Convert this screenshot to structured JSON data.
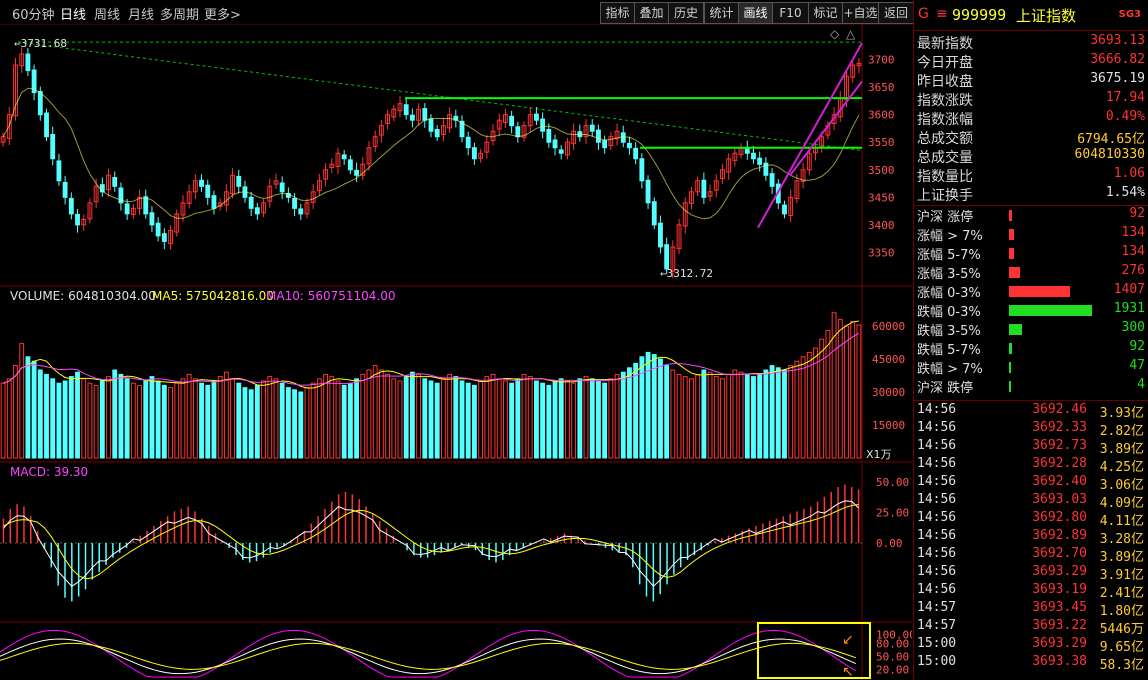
{
  "toolbar": {
    "tabs": [
      "60分钟",
      "日线",
      "周线",
      "月线",
      "多周期",
      "更多>"
    ],
    "active_tab": "日线",
    "tools": [
      "指标",
      "叠加",
      "历史",
      "统计",
      "画线",
      "F10",
      "标记",
      "+自选",
      "返回"
    ],
    "active_tool": "画线"
  },
  "chart_data": [
    {
      "type": "candlestick",
      "pane": "price",
      "title": "",
      "ylim": [
        3300,
        3750
      ],
      "y_ticks": [
        "3700",
        "3650",
        "3600",
        "3550",
        "3500",
        "3450",
        "3400",
        "3350"
      ],
      "annotations": [
        "3731.68",
        "3312.72"
      ],
      "high_marker": 3731.68,
      "low_marker": 3312.72,
      "close": [
        3560,
        3600,
        3690,
        3710,
        3680,
        3640,
        3600,
        3560,
        3520,
        3480,
        3450,
        3420,
        3400,
        3410,
        3440,
        3470,
        3460,
        3490,
        3470,
        3440,
        3420,
        3430,
        3450,
        3420,
        3400,
        3380,
        3370,
        3390,
        3420,
        3440,
        3460,
        3480,
        3470,
        3450,
        3430,
        3440,
        3460,
        3490,
        3470,
        3450,
        3430,
        3420,
        3440,
        3470,
        3480,
        3460,
        3450,
        3430,
        3420,
        3440,
        3460,
        3480,
        3500,
        3510,
        3530,
        3520,
        3500,
        3490,
        3510,
        3540,
        3560,
        3580,
        3600,
        3610,
        3620,
        3600,
        3590,
        3610,
        3590,
        3570,
        3560,
        3580,
        3600,
        3590,
        3560,
        3540,
        3520,
        3530,
        3550,
        3570,
        3590,
        3600,
        3580,
        3560,
        3580,
        3600,
        3590,
        3570,
        3550,
        3540,
        3530,
        3550,
        3570,
        3560,
        3580,
        3570,
        3550,
        3540,
        3560,
        3570,
        3550,
        3540,
        3520,
        3480,
        3440,
        3400,
        3360,
        3320,
        3360,
        3400,
        3440,
        3460,
        3480,
        3450,
        3460,
        3480,
        3500,
        3520,
        3530,
        3540,
        3530,
        3520,
        3510,
        3490,
        3470,
        3440,
        3420,
        3450,
        3480,
        3500,
        3530,
        3540,
        3560,
        3580,
        3600,
        3630,
        3670,
        3690,
        3693
      ]
    },
    {
      "type": "bar",
      "pane": "volume",
      "legend": [
        "VOLUME: 604810304.00",
        "MA5: 575042816.00",
        "MA10: 560751104.00"
      ],
      "ylim": [
        0,
        70000
      ],
      "y_ticks": [
        "60000",
        "45000",
        "30000",
        "15000"
      ],
      "unit_label": "X1万",
      "values": [
        34000,
        36000,
        42000,
        52000,
        46000,
        44000,
        40000,
        38000,
        36000,
        34000,
        35000,
        37000,
        39000,
        36000,
        34000,
        33000,
        35000,
        37000,
        40000,
        38000,
        36000,
        34000,
        33000,
        35000,
        37000,
        35000,
        33000,
        32000,
        34000,
        36000,
        38000,
        36000,
        34000,
        33000,
        35000,
        37000,
        39000,
        36000,
        34000,
        32000,
        31000,
        33000,
        35000,
        37000,
        36000,
        34000,
        32000,
        31000,
        30000,
        32000,
        34000,
        36000,
        38000,
        37000,
        35000,
        33000,
        34000,
        36000,
        38000,
        40000,
        42000,
        40000,
        38000,
        36000,
        35000,
        37000,
        39000,
        38000,
        36000,
        35000,
        34000,
        36000,
        38000,
        37000,
        35000,
        34000,
        33000,
        35000,
        37000,
        38000,
        36000,
        35000,
        34000,
        36000,
        38000,
        37000,
        35000,
        34000,
        33000,
        35000,
        36000,
        35000,
        34000,
        36000,
        37000,
        36000,
        35000,
        34000,
        36000,
        38000,
        39000,
        41000,
        43000,
        46000,
        48000,
        47000,
        45000,
        42000,
        40000,
        38000,
        37000,
        36000,
        38000,
        40000,
        39000,
        37000,
        36000,
        38000,
        40000,
        39000,
        38000,
        37000,
        38000,
        40000,
        42000,
        41000,
        40000,
        42000,
        44000,
        46000,
        48000,
        50000,
        54000,
        58000,
        66000,
        63000,
        60000,
        62000,
        60481
      ]
    },
    {
      "type": "line",
      "pane": "macd",
      "legend": [
        "MACD: 39.30"
      ],
      "ylim": [
        -60,
        60
      ],
      "y_ticks": [
        "50.00",
        "25.00",
        "0.00"
      ],
      "values": [
        20,
        28,
        32,
        30,
        22,
        10,
        -5,
        -20,
        -35,
        -45,
        -48,
        -44,
        -38,
        -30,
        -24,
        -18,
        -12,
        -8,
        -4,
        2,
        6,
        10,
        14,
        18,
        22,
        26,
        28,
        30,
        26,
        20,
        14,
        8,
        2,
        -4,
        -10,
        -14,
        -16,
        -15,
        -12,
        -8,
        -4,
        -2,
        2,
        6,
        10,
        16,
        22,
        28,
        34,
        40,
        42,
        40,
        36,
        30,
        24,
        18,
        12,
        6,
        0,
        -6,
        -10,
        -12,
        -12,
        -10,
        -8,
        -6,
        -4,
        -2,
        -4,
        -6,
        -10,
        -14,
        -16,
        -14,
        -10,
        -6,
        -4,
        -2,
        0,
        2,
        4,
        6,
        8,
        6,
        4,
        2,
        0,
        -2,
        -4,
        -6,
        -8,
        -10,
        -20,
        -34,
        -44,
        -48,
        -42,
        -34,
        -26,
        -20,
        -14,
        -10,
        -6,
        -2,
        2,
        4,
        6,
        8,
        10,
        12,
        14,
        16,
        18,
        20,
        22,
        24,
        26,
        28,
        30,
        34,
        38,
        42,
        46,
        48,
        46,
        44
      ]
    },
    {
      "type": "line",
      "pane": "oscillator",
      "y_ticks": [
        "100.00",
        "80.00",
        "50.00",
        "20.00"
      ],
      "ylim": [
        0,
        120
      ]
    }
  ],
  "sidebar": {
    "code": "999999",
    "name": "上证指数",
    "g_label": "G",
    "menu_label": "≡",
    "badge": "SG3",
    "quotes": [
      {
        "label": "最新指数",
        "value": "3693.13",
        "color": "#ff3333"
      },
      {
        "label": "今日开盘",
        "value": "3666.82",
        "color": "#ff3333"
      },
      {
        "label": "昨日收盘",
        "value": "3675.19",
        "color": "#e0e0e0"
      },
      {
        "label": "指数涨跌",
        "value": "17.94",
        "color": "#ff3333"
      },
      {
        "label": "指数涨幅",
        "value": "0.49%",
        "color": "#ff3333"
      },
      {
        "label": "总成交额",
        "value": "6794.65亿",
        "color": "#ffcc33"
      },
      {
        "label": "总成交量",
        "value": "604810330",
        "color": "#ffcc33"
      },
      {
        "label": "指数量比",
        "value": "1.06",
        "color": "#ff3333"
      },
      {
        "label": "上证换手",
        "value": "1.54%",
        "color": "#e0e0e0"
      }
    ],
    "breadth": [
      {
        "label": "沪深 涨停",
        "value": "92",
        "color": "#ff3333",
        "ratio": 0.02
      },
      {
        "label": "涨幅 > 7%",
        "value": "134",
        "color": "#ff3333",
        "ratio": 0.03
      },
      {
        "label": "涨幅 5-7%",
        "value": "134",
        "color": "#ff3333",
        "ratio": 0.03
      },
      {
        "label": "涨幅 3-5%",
        "value": "276",
        "color": "#ff3333",
        "ratio": 0.07
      },
      {
        "label": "涨幅 0-3%",
        "value": "1407",
        "color": "#ff3333",
        "ratio": 0.38
      },
      {
        "label": "跌幅 0-3%",
        "value": "1931",
        "color": "#22dd22",
        "ratio": 0.52
      },
      {
        "label": "跌幅 3-5%",
        "value": "300",
        "color": "#22dd22",
        "ratio": 0.08
      },
      {
        "label": "跌幅 5-7%",
        "value": "92",
        "color": "#22dd22",
        "ratio": 0.02
      },
      {
        "label": "跌幅 > 7%",
        "value": "47",
        "color": "#22dd22",
        "ratio": 0.01
      },
      {
        "label": "沪深 跌停",
        "value": "4",
        "color": "#22dd22",
        "ratio": 0.005
      }
    ],
    "ticks": [
      {
        "time": "14:56",
        "price": "3692.46",
        "vol": "3.93亿"
      },
      {
        "time": "14:56",
        "price": "3692.33",
        "vol": "2.82亿"
      },
      {
        "time": "14:56",
        "price": "3692.73",
        "vol": "3.89亿"
      },
      {
        "time": "14:56",
        "price": "3692.28",
        "vol": "4.25亿"
      },
      {
        "time": "14:56",
        "price": "3692.40",
        "vol": "3.06亿"
      },
      {
        "time": "14:56",
        "price": "3693.03",
        "vol": "4.09亿"
      },
      {
        "time": "14:56",
        "price": "3692.80",
        "vol": "4.11亿"
      },
      {
        "time": "14:56",
        "price": "3692.89",
        "vol": "3.28亿"
      },
      {
        "time": "14:56",
        "price": "3692.70",
        "vol": "3.89亿"
      },
      {
        "time": "14:56",
        "price": "3693.29",
        "vol": "3.91亿"
      },
      {
        "time": "14:56",
        "price": "3693.19",
        "vol": "2.41亿"
      },
      {
        "time": "14:57",
        "price": "3693.45",
        "vol": "1.80亿"
      },
      {
        "time": "14:57",
        "price": "3693.22",
        "vol": "5446万"
      },
      {
        "time": "15:00",
        "price": "3693.29",
        "vol": "9.65亿"
      },
      {
        "time": "15:00",
        "price": "3693.38",
        "vol": "58.3亿"
      }
    ]
  },
  "colors": {
    "up": "#ff3333",
    "down": "#54ffff",
    "ma5": "#ffffff",
    "ma10": "#ffff00",
    "ma20": "#ff00ff",
    "support": "#00ff00",
    "trend": "#d020d0",
    "grid": "#7a0000"
  }
}
